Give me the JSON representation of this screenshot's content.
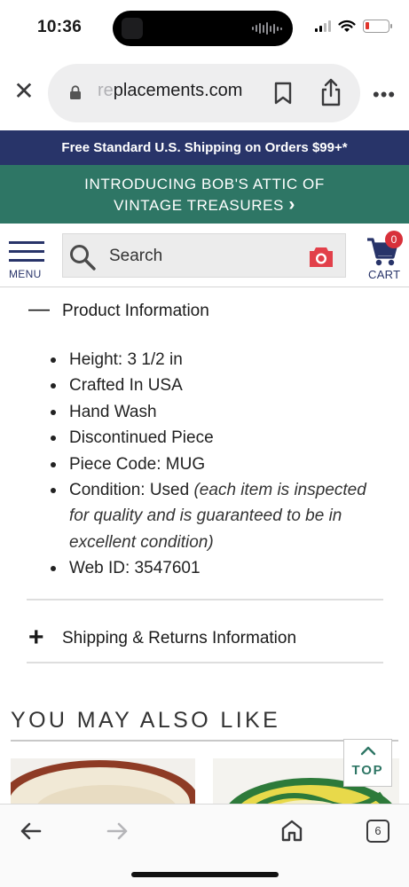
{
  "status_bar": {
    "time": "10:36"
  },
  "browser": {
    "url_faded": "re",
    "url_domain": "placements.com",
    "tab_count": "6"
  },
  "banners": {
    "shipping": "Free Standard U.S. Shipping on Orders $99+*",
    "promo_line1": "INTRODUCING BOB'S ATTIC OF",
    "promo_line2": "VINTAGE TREASURES",
    "promo_chevron": "›"
  },
  "header": {
    "menu_label": "MENU",
    "search_placeholder": "Search",
    "cart_count": "0",
    "cart_label": "CART"
  },
  "product_info": {
    "expanded_sign": "—",
    "title": "Product Information",
    "items": [
      {
        "text": "Height: 3 1/2 in"
      },
      {
        "text": "Crafted In USA"
      },
      {
        "text": "Hand Wash"
      },
      {
        "text": "Discontinued Piece"
      },
      {
        "text": "Piece Code: MUG"
      },
      {
        "text": "Condition: Used",
        "note": "(each item is inspected for quality and is guaranteed to be in excellent condition)"
      },
      {
        "text": "Web ID: 3547601"
      }
    ]
  },
  "shipping_section": {
    "collapsed_sign": "+",
    "title": "Shipping & Returns Information"
  },
  "recommendations": {
    "title": "YOU MAY ALSO LIKE"
  },
  "back_to_top": {
    "label": "TOP"
  },
  "colors": {
    "navy": "#283469",
    "teal": "#2e7665",
    "camera_red": "#e2404a",
    "badge_red": "#d8303a"
  },
  "icons": [
    "close-icon",
    "lock-icon",
    "bookmark-icon",
    "share-icon",
    "more-icon",
    "menu-icon",
    "search-icon",
    "camera-icon",
    "cart-icon",
    "minus-icon",
    "plus-icon",
    "chevron-up-icon",
    "back-arrow-icon",
    "forward-arrow-icon",
    "home-icon",
    "tabs-icon"
  ]
}
